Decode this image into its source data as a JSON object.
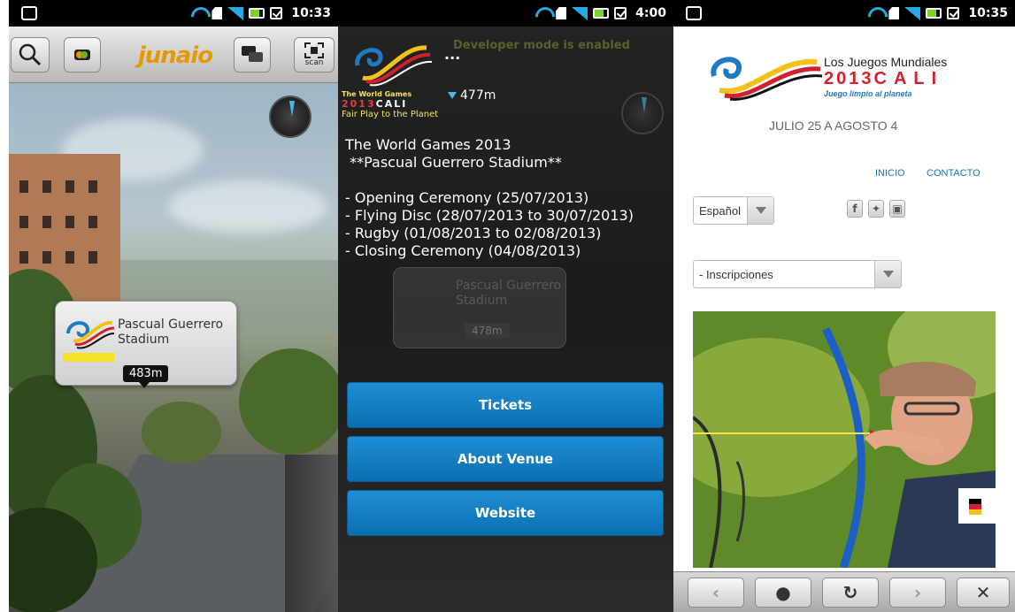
{
  "status_bars": [
    {
      "time": "10:33"
    },
    {
      "time": "4:00"
    },
    {
      "time": "10:35"
    }
  ],
  "panel1": {
    "app_logo": "junaio",
    "toolbar": {
      "search_icon": "search-icon",
      "channel_icon": "channel-icon",
      "chat_icon": "chat-icon",
      "scan_label": "scan"
    },
    "poi": {
      "name": "Pascual Guerrero Stadium",
      "distance": "483m"
    }
  },
  "panel2": {
    "banner": "Developer mode is enabled",
    "ellipsis": "...",
    "logo_text": {
      "line1": "The World Games",
      "line2_year": "2013",
      "line2_city": "CALI",
      "line3": "Fair Play to the Planet"
    },
    "distance": "477m",
    "venue_lines": [
      "The World Games 2013",
      " **Pascual Guerrero Stadium**",
      "",
      "- Opening Ceremony (25/07/2013)",
      "- Flying Disc (28/07/2013 to 30/07/2013)",
      "- Rugby (01/08/2013 to 02/08/2013)",
      "- Closing Ceremony (04/08/2013)"
    ],
    "ghost_poi": {
      "name": "Pascual Guerrero Stadium",
      "distance": "478m"
    },
    "buttons": {
      "tickets": "Tickets",
      "about": "About Venue",
      "website": "Website"
    }
  },
  "panel3": {
    "title_line1": "Los Juegos Mundiales",
    "title_year": "2013",
    "title_city": "CALI",
    "tagline": "Juego limpio al planeta",
    "dates": "JULIO 25 A AGOSTO 4",
    "nav": {
      "inicio": "INICIO",
      "contacto": "CONTACTO"
    },
    "language_select": "Español",
    "social_icons": [
      "facebook-icon",
      "twitter-icon",
      "youtube-icon"
    ],
    "inscriptions_select": "- Inscripciones",
    "photo_subject": "archer-photo",
    "browser_bar": [
      "back-icon",
      "stop-icon",
      "refresh-icon",
      "forward-icon",
      "close-icon"
    ]
  }
}
